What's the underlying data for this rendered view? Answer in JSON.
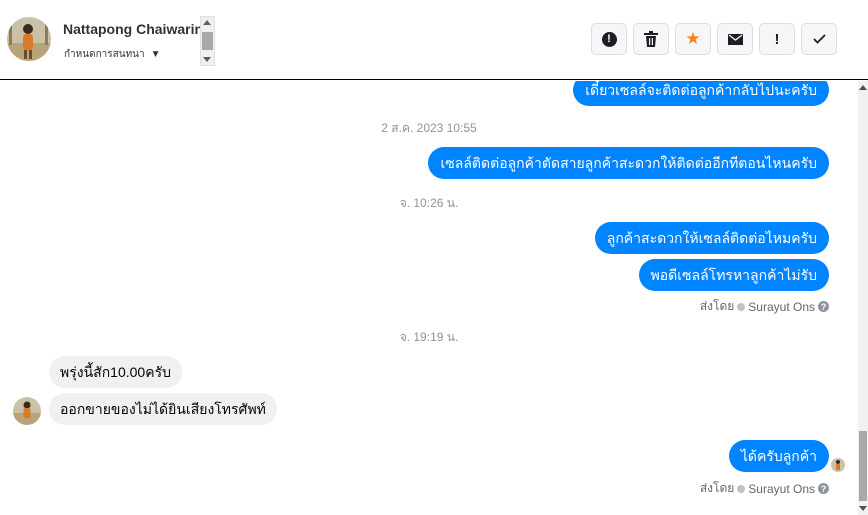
{
  "header": {
    "contact_name": "Nattapong Chaiwarin",
    "conversation_label": "กำหนดการสนทนา",
    "actions": [
      {
        "name": "report-button",
        "icon": "exclamation-circle-icon"
      },
      {
        "name": "delete-button",
        "icon": "trash-icon"
      },
      {
        "name": "star-button",
        "icon": "star-icon"
      },
      {
        "name": "mark-unread-button",
        "icon": "envelope-icon"
      },
      {
        "name": "mark-important-button",
        "icon": "exclamation-icon"
      },
      {
        "name": "mark-done-button",
        "icon": "checkmark-icon"
      }
    ]
  },
  "messages": {
    "out_1": "เดี๋ยวเซลล์จะติดต่อลูกค้ากลับไปนะครับ",
    "time_1": "2 ส.ค. 2023 10:55",
    "out_2": "เซลล์ติดต่อลูกค้าตัดสายลูกค้าสะดวกให้ติดต่ออีกทีตอนไหนครับ",
    "time_2": "จ. 10:26 น.",
    "out_3": "ลูกค้าสะดวกให้เซลล์ติดต่อไหมครับ",
    "out_4": "พอดีเซลล์โทรหาลูกค้าไม่รับ",
    "time_3": "จ. 19:19 น.",
    "in_1": "พรุ่งนี้สัก10.00ครับ",
    "in_2": "ออกขายของไม่ได้ยินเสียงโทรศัพท์",
    "out_5": "ได้ครับลูกค้า"
  },
  "sent_by": {
    "label": "ส่งโดย",
    "agent": "Surayut Ons",
    "help": "?"
  },
  "colors": {
    "outgoing_bubble": "#0084ff",
    "incoming_bubble": "#f1f0f0",
    "star": "#f5821f"
  }
}
